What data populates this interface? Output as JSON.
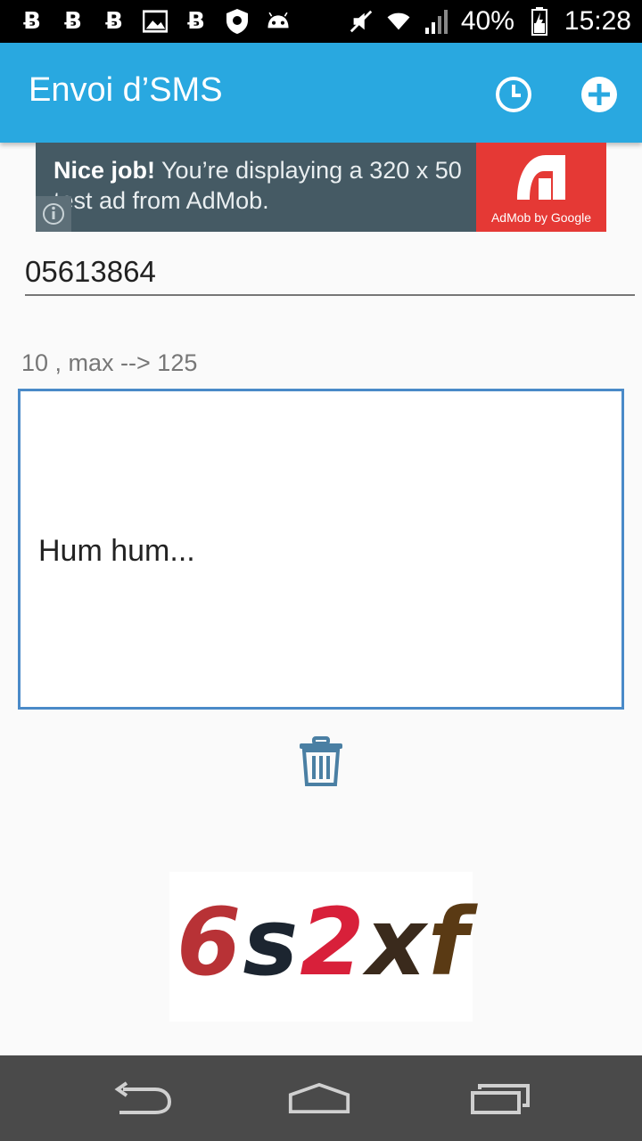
{
  "status_bar": {
    "icons": [
      "b-app-icon",
      "b-app-icon",
      "b-app-icon",
      "image-icon",
      "b-app-icon",
      "shield-icon",
      "android-icon",
      "mute-icon",
      "wifi-icon",
      "signal-icon"
    ],
    "battery": "40%",
    "time": "15:28"
  },
  "app_bar": {
    "title": "Envoi d’SMS",
    "actions": [
      "clock-icon",
      "add-circle-icon"
    ]
  },
  "ad": {
    "bold": "Nice job!",
    "text": " You’re displaying a 320 x 50 test ad from AdMob.",
    "brand": "AdMob by Google"
  },
  "form": {
    "phone_value": "05613864",
    "counter": "10 , max --> 125",
    "message": "Hum hum..."
  },
  "captcha": {
    "chars": [
      "6",
      "s",
      "2",
      "x",
      "f"
    ],
    "colors": [
      "#b83236",
      "#1c2530",
      "#d8203a",
      "#3a2a1c",
      "#5a3a14"
    ]
  },
  "nav_bar": {
    "buttons": [
      "back-icon",
      "home-icon",
      "recents-icon"
    ]
  },
  "colors": {
    "accent": "#29a8e0",
    "message_border": "#4a8ac8",
    "nav_bg": "#4a4a4a"
  }
}
